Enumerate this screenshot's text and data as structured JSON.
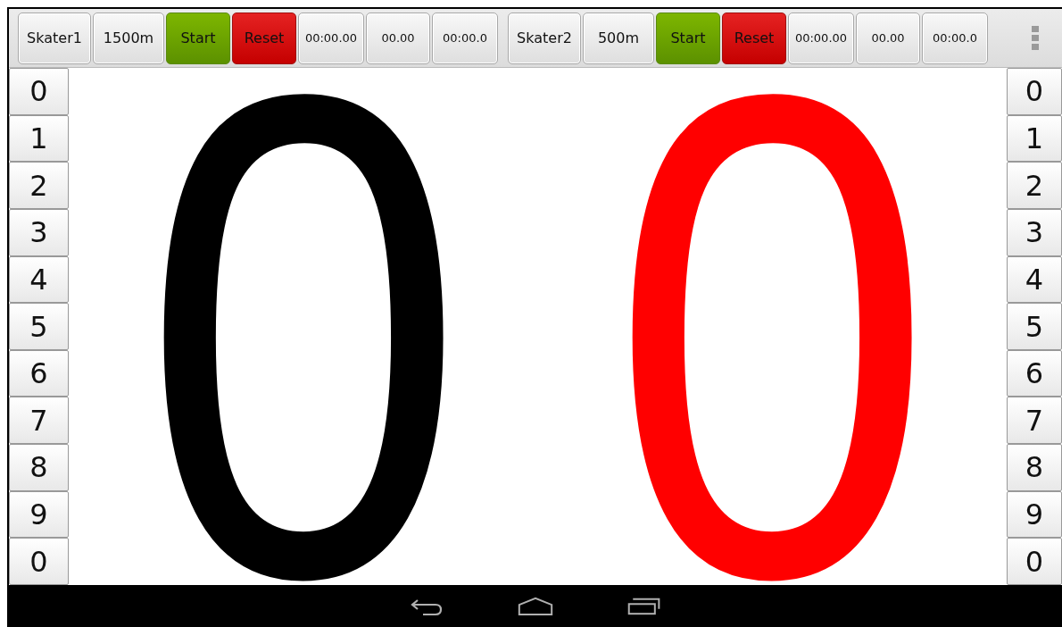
{
  "skaters": [
    {
      "name": "Skater1",
      "distance": "1500m",
      "start": "Start",
      "reset": "Reset",
      "time": "00:00.00",
      "split": "00.00",
      "lap": "00:00.0"
    },
    {
      "name": "Skater2",
      "distance": "500m",
      "start": "Start",
      "reset": "Reset",
      "time": "00:00.00",
      "split": "00.00",
      "lap": "00:00.0"
    }
  ],
  "left_digits": [
    "0",
    "1",
    "2",
    "3",
    "4",
    "5",
    "6",
    "7",
    "8",
    "9",
    "0"
  ],
  "right_digits": [
    "0",
    "1",
    "2",
    "3",
    "4",
    "5",
    "6",
    "7",
    "8",
    "9",
    "0"
  ],
  "scores": [
    {
      "value": "0",
      "color": "#000000"
    },
    {
      "value": "0",
      "color": "#ff0000"
    }
  ]
}
